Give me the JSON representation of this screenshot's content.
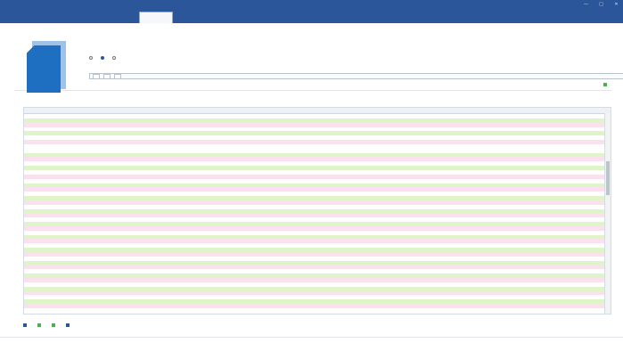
{
  "window": {
    "title": ""
  },
  "ribbon": {
    "tabs": [
      {
        "label": ""
      },
      {
        "label": ""
      },
      {
        "label": ""
      },
      {
        "label": ""
      },
      {
        "label": "",
        "active": true
      },
      {
        "label": ""
      },
      {
        "label": ""
      },
      {
        "label": ""
      },
      {
        "label": ""
      }
    ],
    "right": [
      {
        "label": ""
      },
      {
        "label": ""
      }
    ]
  },
  "panel": {
    "section1_title": "",
    "radios": [
      {
        "label": "",
        "selected": false
      },
      {
        "label": "",
        "selected": true
      },
      {
        "label": "",
        "selected": false
      }
    ],
    "section2_title": "",
    "filter_values": [
      {
        "text": ""
      },
      {
        "text": ""
      },
      {
        "text": ""
      }
    ],
    "action_label": ""
  },
  "list": {
    "title": "",
    "columns": [
      "",
      "",
      "",
      ""
    ],
    "rows": [
      {
        "style": "plain"
      },
      {
        "style": "green"
      },
      {
        "style": "pink"
      },
      {
        "style": "plain"
      },
      {
        "style": "green"
      },
      {
        "style": "plain"
      },
      {
        "style": "pink"
      },
      {
        "style": "plain"
      },
      {
        "style": "plain"
      },
      {
        "style": "green"
      },
      {
        "style": "pink"
      },
      {
        "style": "plain"
      },
      {
        "style": "green"
      },
      {
        "style": "plain"
      },
      {
        "style": "pink"
      },
      {
        "style": "plain"
      },
      {
        "style": "green"
      },
      {
        "style": "pink"
      },
      {
        "style": "plain"
      },
      {
        "style": "green"
      },
      {
        "style": "pink"
      },
      {
        "style": "plain"
      },
      {
        "style": "green"
      },
      {
        "style": "pink"
      },
      {
        "style": "plain"
      },
      {
        "style": "green"
      },
      {
        "style": "pink"
      },
      {
        "style": "plain"
      },
      {
        "style": "green"
      },
      {
        "style": "pink"
      },
      {
        "style": "plain"
      },
      {
        "style": "green"
      },
      {
        "style": "pink"
      },
      {
        "style": "plain"
      },
      {
        "style": "green"
      },
      {
        "style": "pink"
      },
      {
        "style": "plain"
      },
      {
        "style": "green"
      },
      {
        "style": "pink"
      },
      {
        "style": "plain"
      },
      {
        "style": "green"
      },
      {
        "style": "pink"
      },
      {
        "style": "plain"
      },
      {
        "style": "green"
      },
      {
        "style": "pink"
      },
      {
        "style": "plain"
      }
    ]
  },
  "bottom_actions": [
    {
      "label": ""
    },
    {
      "label": ""
    },
    {
      "label": ""
    },
    {
      "label": ""
    }
  ],
  "status": [
    {
      "text": ""
    },
    {
      "text": ""
    },
    {
      "text": ""
    },
    {
      "text": ""
    }
  ],
  "colors": {
    "accent": "#2b579a",
    "row_green": "#dff5c9",
    "row_pink": "#fbe0ee"
  }
}
